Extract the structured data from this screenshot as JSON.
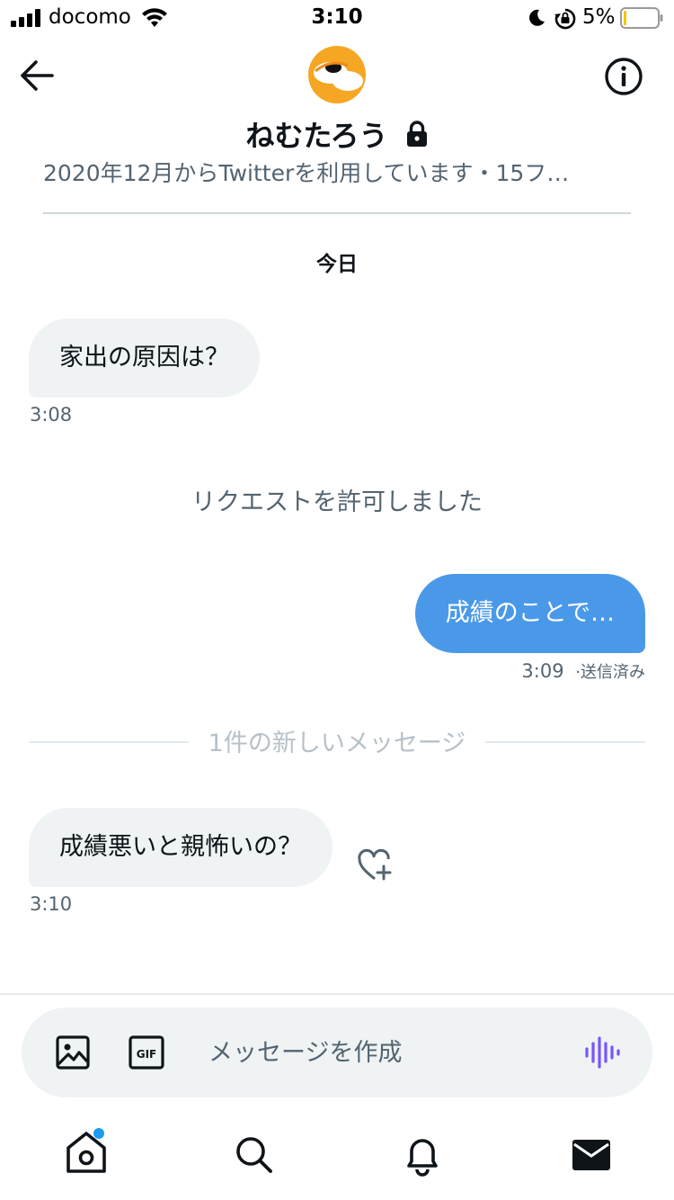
{
  "status_bar": {
    "carrier": "docomo",
    "time": "3:10",
    "battery": "5%"
  },
  "header": {
    "title": "ねむたろう",
    "subtitle": "2020年12月からTwitterを利用しています・15フ…",
    "back_icon": "arrow-left-icon",
    "info_icon": "info-circle-icon",
    "lock_icon": "lock-icon"
  },
  "conversation": {
    "day_label": "今日",
    "messages": [
      {
        "direction": "incoming",
        "text": "家出の原因は？",
        "time": "3:08"
      },
      {
        "direction": "system",
        "text": "リクエストを許可しました"
      },
      {
        "direction": "outgoing",
        "text": "成績のことで…",
        "time": "3:09",
        "status": "·送信済み"
      },
      {
        "direction": "divider",
        "text": "1件の新しいメッセージ"
      },
      {
        "direction": "incoming",
        "text": "成績悪いと親怖いの？",
        "time": "3:10"
      }
    ]
  },
  "composer": {
    "placeholder": "メッセージを作成",
    "icons": [
      "image-icon",
      "gif-icon",
      "voice-icon"
    ]
  },
  "tab_bar": {
    "items": [
      "home-icon",
      "search-icon",
      "notifications-icon",
      "messages-icon"
    ]
  },
  "colors": {
    "accent": "#4a99e9",
    "incoming_bubble": "#eff3f4",
    "muted_text": "#536471",
    "voice_icon": "#7856ff"
  }
}
